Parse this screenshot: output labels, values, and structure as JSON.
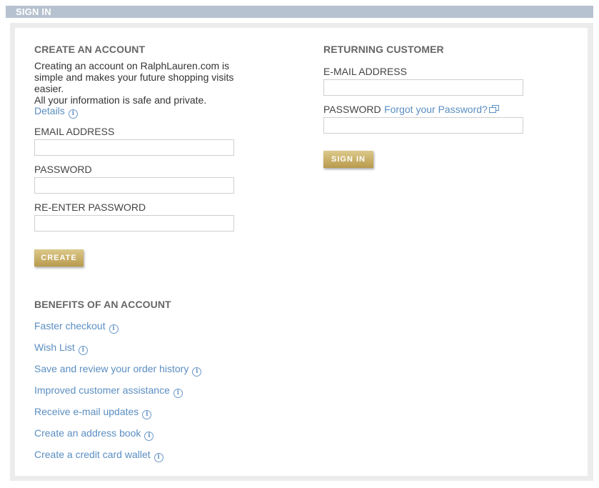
{
  "header": {
    "title": "SIGN IN"
  },
  "create": {
    "title": "CREATE AN ACCOUNT",
    "intro_line1": "Creating an account on RalphLauren.com is",
    "intro_line2": "simple and makes your future shopping visits",
    "intro_line3": "easier.",
    "intro_line4": "All your information is safe and private.",
    "details_link": "Details",
    "email_label": "EMAIL ADDRESS",
    "password_label": "PASSWORD",
    "reenter_label": "RE-ENTER PASSWORD",
    "create_button": "CREATE"
  },
  "benefits": {
    "title": "BENEFITS OF AN ACCOUNT",
    "items": [
      "Faster checkout",
      "Wish List",
      "Save and review your order history",
      "Improved customer assistance",
      "Receive e-mail updates",
      "Create an address book",
      "Create a credit card wallet"
    ]
  },
  "returning": {
    "title": "RETURNING CUSTOMER",
    "email_label": "E-MAIL ADDRESS",
    "password_label": "PASSWORD",
    "forgot_link": "Forgot your Password?",
    "signin_button": "SIGN IN"
  },
  "icons": {
    "info": "info-icon",
    "popup": "new-window-icon"
  },
  "colors": {
    "header": "#b6c2cf",
    "link": "#5b8ec1",
    "button": "#c8ae62"
  }
}
